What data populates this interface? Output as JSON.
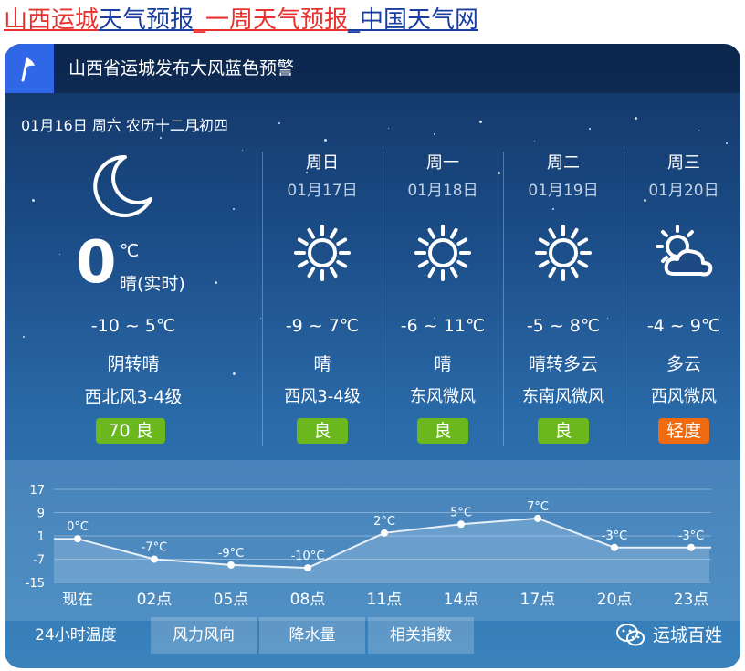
{
  "header": {
    "part1": "山西运城",
    "part2": "天气预报",
    "part3": "_一周天气预报",
    "part4": "_中国天气网"
  },
  "alert": {
    "text": "山西省运城发布大风蓝色预警",
    "icon": "flag-icon"
  },
  "date_line": "01月16日 周六 农历十二月初四",
  "today": {
    "icon": "moon-icon",
    "temp": "0",
    "unit": "℃",
    "desc": "晴(实时)",
    "range": "-10 ~ 5℃",
    "condition": "阴转晴",
    "wind": "西北风3-4级",
    "aqi": "70  良",
    "aqi_color": "#6ab81d"
  },
  "days": [
    {
      "name": "周日",
      "date": "01月17日",
      "icon": "sun-icon",
      "range": "-9 ~ 7℃",
      "condition": "晴",
      "wind": "西风3-4级",
      "aqi": "良",
      "aqi_color": "#6ab81d"
    },
    {
      "name": "周一",
      "date": "01月18日",
      "icon": "sun-icon",
      "range": "-6 ~ 11℃",
      "condition": "晴",
      "wind": "东风微风",
      "aqi": "良",
      "aqi_color": "#6ab81d"
    },
    {
      "name": "周二",
      "date": "01月19日",
      "icon": "sun-icon",
      "range": "-5 ~ 8℃",
      "condition": "晴转多云",
      "wind": "东南风微风",
      "aqi": "良",
      "aqi_color": "#6ab81d"
    },
    {
      "name": "周三",
      "date": "01月20日",
      "icon": "sun-cloud-icon",
      "range": "-4 ~ 9℃",
      "condition": "多云",
      "wind": "西风微风",
      "aqi": "轻度",
      "aqi_color": "#f06a0f"
    }
  ],
  "chart_data": {
    "type": "line",
    "categories": [
      "现在",
      "02点",
      "05点",
      "08点",
      "11点",
      "14点",
      "17点",
      "20点",
      "23点"
    ],
    "values": [
      0,
      -7,
      -9,
      -10,
      2,
      5,
      7,
      -3,
      -3
    ],
    "point_labels": [
      "0°C",
      "-7°C",
      "-9°C",
      "-10°C",
      "2°C",
      "5°C",
      "7°C",
      "-3°C",
      "-3°C"
    ],
    "yticks": [
      "17",
      "9",
      "1",
      "-7",
      "-15"
    ],
    "ytick_values": [
      17,
      9,
      1,
      -7,
      -15
    ],
    "ylim": [
      -15,
      17
    ],
    "grid": true
  },
  "tabs": [
    {
      "label": "24小时温度",
      "active": true
    },
    {
      "label": "风力风向",
      "active": false
    },
    {
      "label": "降水量",
      "active": false
    },
    {
      "label": "相关指数",
      "active": false
    }
  ],
  "brand": {
    "label": "运城百姓",
    "icon": "wechat-icon"
  }
}
